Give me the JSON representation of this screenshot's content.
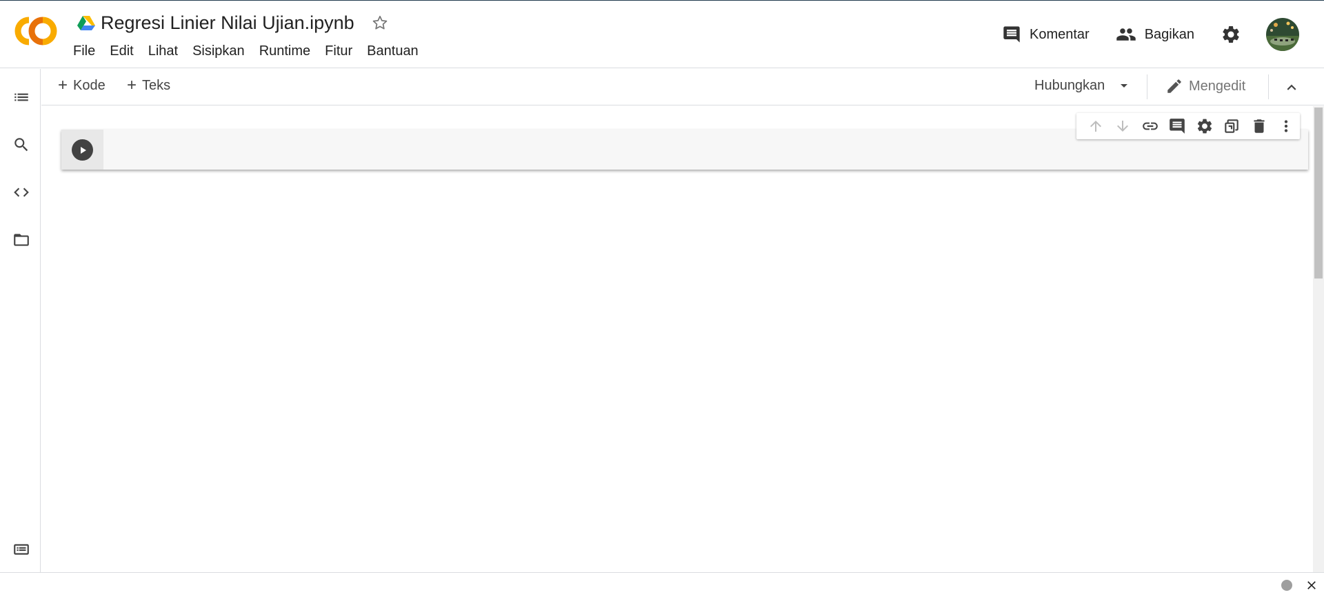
{
  "app": {
    "logo_text": "CO",
    "notebook_title": "Regresi Linier Nilai Ujian.ipynb"
  },
  "menu": {
    "items": [
      "File",
      "Edit",
      "Lihat",
      "Sisipkan",
      "Runtime",
      "Fitur",
      "Bantuan"
    ]
  },
  "header": {
    "comment_label": "Komentar",
    "share_label": "Bagikan"
  },
  "toolbar": {
    "add_code_label": "Kode",
    "add_text_label": "Teks",
    "connect_label": "Hubungkan",
    "editing_label": "Mengedit"
  },
  "sidebar": {
    "icons": [
      "toc-icon",
      "search-icon",
      "code-snippets-icon",
      "folder-icon"
    ],
    "bottom_icon": "terminal-icon"
  },
  "cell_toolbar": {
    "icons": [
      "arrow-up-icon",
      "arrow-down-icon",
      "link-icon",
      "comment-icon",
      "gear-icon",
      "mirror-cell-icon",
      "delete-icon",
      "more-vert-icon"
    ]
  },
  "colors": {
    "logo_orange": "#F9AB00",
    "logo_dark_orange": "#E8710A",
    "icon_gray": "#444444",
    "disabled_gray": "#BDBDBD"
  }
}
